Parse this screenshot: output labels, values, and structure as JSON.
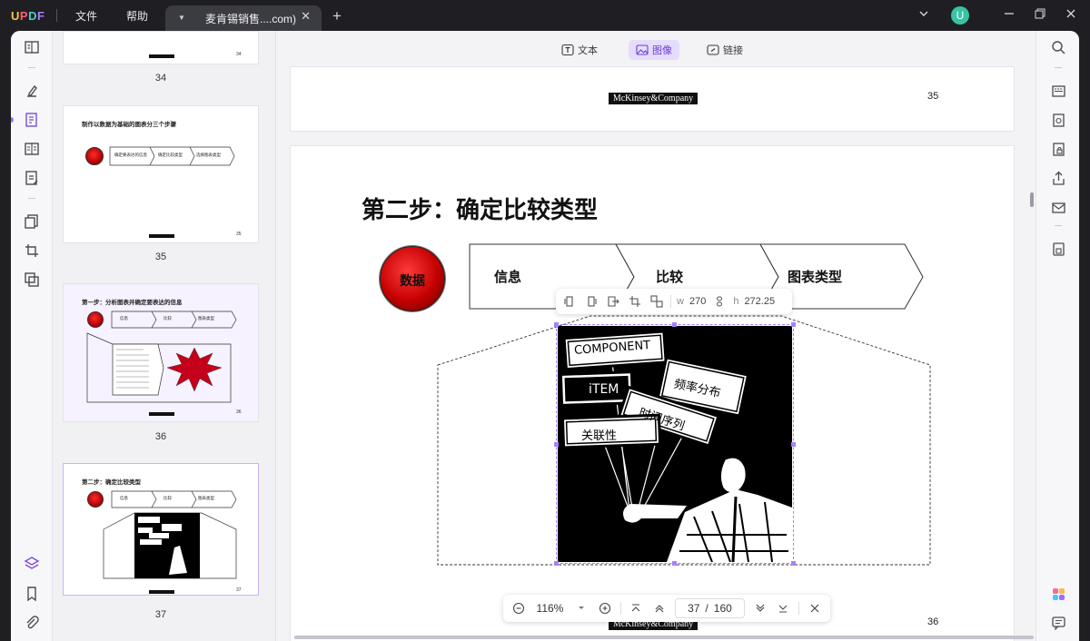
{
  "app": {
    "logo": "UPDF",
    "menu": [
      "文件",
      "帮助"
    ],
    "tab_title": "麦肯锡销售....com)",
    "avatar_letter": "U"
  },
  "edit_tools": [
    {
      "label": "文本",
      "active": false
    },
    {
      "label": "图像",
      "active": true
    },
    {
      "label": "链接",
      "active": false
    }
  ],
  "thumbnails": [
    {
      "page": "34"
    },
    {
      "page": "35",
      "title": "制作以数据为基础的图表分三个步骤",
      "steps": [
        "确定要表达的信息",
        "确定比较类型",
        "选择图表类型"
      ]
    },
    {
      "page": "36",
      "title": "第一步：分析图表并确定要表达的信息",
      "steps": [
        "信息",
        "比较",
        "图表类型"
      ]
    },
    {
      "page": "37",
      "title": "第二步：确定比较类型",
      "steps": [
        "信息",
        "比较",
        "图表类型"
      ]
    }
  ],
  "document": {
    "top_page": {
      "logo": "McKinsey&Company",
      "page_number": "35"
    },
    "main_page": {
      "title": "第二步：确定比较类型",
      "ball_label": "数据",
      "chevrons": [
        "信息",
        "比较",
        "图表类型"
      ],
      "logo": "McKinsey&Company",
      "page_number": "36"
    },
    "image": {
      "signs": [
        "COMPONENT",
        "iTEM",
        "频率分布",
        "时间序列",
        "关联性"
      ]
    }
  },
  "image_toolbar": {
    "w_label": "w",
    "w_value": "270",
    "h_label": "h",
    "h_value": "272.25"
  },
  "zoom_bar": {
    "zoom": "116%",
    "current_page": "37",
    "separator": "/",
    "total_pages": "160"
  }
}
